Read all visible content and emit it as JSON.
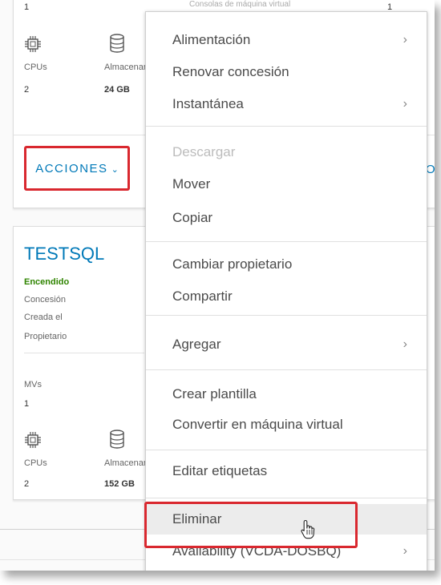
{
  "vm1": {
    "top_value": "1",
    "cpus_label": "CPUs",
    "cpus_value": "2",
    "storage_label": "Almacenamiento",
    "storage_value": "24 GB",
    "actions_label": "ACCIONES",
    "right_top_label": "Consolas de máquina virtual",
    "right_top_value": "1",
    "right_edge_text": "O"
  },
  "vm2": {
    "name": "TESTSQL",
    "status": "Encendido",
    "status_color": "#2f8400",
    "lease_label": "Concesión",
    "created_label": "Creada el",
    "owner_label": "Propietario",
    "vms_label": "MVs",
    "vms_value": "1",
    "cpus_label": "CPUs",
    "cpus_value": "2",
    "storage_label": "Almacenamiento",
    "storage_value": "152 GB"
  },
  "menu": {
    "items": [
      {
        "label": "Alimentación",
        "submenu": true,
        "disabled": false
      },
      {
        "label": "Renovar concesión",
        "submenu": false,
        "disabled": false
      },
      {
        "label": "Instantánea",
        "submenu": true,
        "disabled": false
      },
      {
        "label": "Descargar",
        "submenu": false,
        "disabled": true
      },
      {
        "label": "Mover",
        "submenu": false,
        "disabled": false
      },
      {
        "label": "Copiar",
        "submenu": false,
        "disabled": false
      },
      {
        "label": "Cambiar propietario",
        "submenu": false,
        "disabled": false
      },
      {
        "label": "Compartir",
        "submenu": false,
        "disabled": false
      },
      {
        "label": "Agregar",
        "submenu": true,
        "disabled": false
      },
      {
        "label": "Crear plantilla",
        "submenu": false,
        "disabled": false
      },
      {
        "label": "Convertir en máquina virtual",
        "submenu": false,
        "disabled": false
      },
      {
        "label": "Editar etiquetas",
        "submenu": false,
        "disabled": false
      },
      {
        "label": "Eliminar",
        "submenu": false,
        "disabled": false,
        "hovered": true
      },
      {
        "label": "Availability (VCDA-DOSBQ)",
        "submenu": true,
        "disabled": false
      }
    ],
    "submenu_arrow": "›"
  },
  "colors": {
    "accent": "#0079b8",
    "highlight_border": "#d9282f"
  },
  "icons": [
    "cpu-icon",
    "storage-icon",
    "chevron-down-icon",
    "chevron-right-icon",
    "hand-cursor-icon"
  ]
}
